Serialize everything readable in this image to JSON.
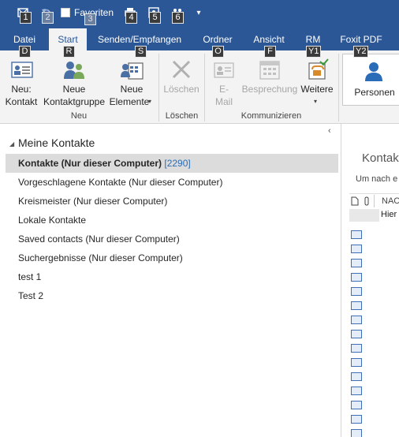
{
  "qat": {
    "favorites_label": "Favoriten",
    "keytips": [
      "1",
      "2",
      "3",
      "4",
      "5",
      "6"
    ]
  },
  "tabs": [
    {
      "label": "Datei",
      "keytip": "D"
    },
    {
      "label": "Start",
      "keytip": "R",
      "active": true
    },
    {
      "label": "Senden/Empfangen",
      "keytip": "S"
    },
    {
      "label": "Ordner",
      "keytip": "O"
    },
    {
      "label": "Ansicht",
      "keytip": "F"
    },
    {
      "label": "RM",
      "keytip": "Y1"
    },
    {
      "label": "Foxit PDF",
      "keytip": "Y2"
    }
  ],
  "ribbon": {
    "neu_kontakt": [
      "Neu:",
      "Kontakt"
    ],
    "neue_kontaktgruppe": [
      "Neue",
      "Kontaktgruppe"
    ],
    "neue_elemente": [
      "Neue",
      "Elemente"
    ],
    "group_neu": "Neu",
    "loeschen": "Löschen",
    "group_loeschen": "Löschen",
    "email": [
      "E-",
      "Mail"
    ],
    "besprechung": "Besprechung",
    "weitere": "Weitere",
    "group_kommunizieren": "Kommunizieren",
    "personen": "Personen"
  },
  "nav": {
    "section_title": "Meine Kontakte",
    "folders": [
      {
        "name": "Kontakte (Nur dieser Computer)",
        "count": "[2290]",
        "selected": true
      },
      {
        "name": "Vorgeschlagene Kontakte (Nur dieser Computer)"
      },
      {
        "name": "Kreismeister (Nur dieser Computer)"
      },
      {
        "name": "Lokale Kontakte"
      },
      {
        "name": "Saved contacts (Nur dieser Computer)"
      },
      {
        "name": "Suchergebnisse (Nur dieser Computer)"
      },
      {
        "name": "test 1"
      },
      {
        "name": "Test 2"
      }
    ]
  },
  "content": {
    "title_partial": "Kontakt",
    "search_partial": "Um nach e",
    "column_name_partial": "NAC",
    "row_hint_partial": "Hier"
  },
  "colors": {
    "accent": "#2b5797",
    "ribbon_bg": "#f3f3f3",
    "selected_bg": "#dcdcdc",
    "count": "#2b6cb8"
  }
}
